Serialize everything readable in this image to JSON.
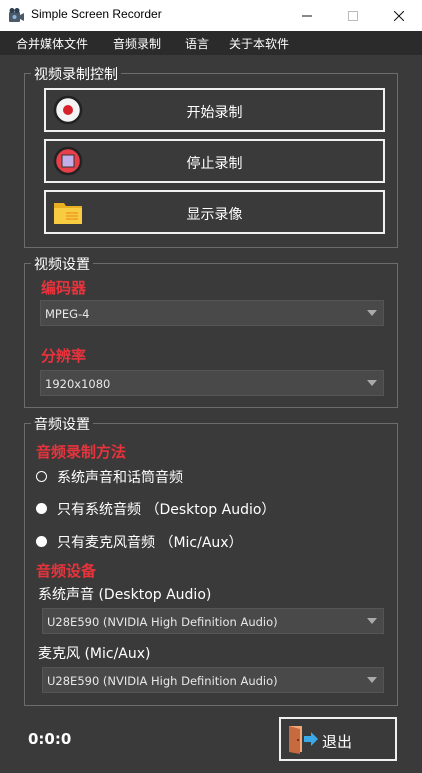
{
  "window": {
    "title": "Simple Screen Recorder"
  },
  "menu": [
    "合并媒体文件",
    "音频录制",
    "语言",
    "关于本软件"
  ],
  "record_group": {
    "title": "视频录制控制",
    "buttons": [
      {
        "label": "开始录制",
        "icon": "record-icon"
      },
      {
        "label": "停止录制",
        "icon": "stop-icon"
      },
      {
        "label": "显示录像",
        "icon": "folder-icon"
      }
    ]
  },
  "video_group": {
    "title": "视频设置",
    "encoder_label": "编码器",
    "encoder_value": "MPEG-4",
    "resolution_label": "分辨率",
    "resolution_value": "1920x1080"
  },
  "audio_group": {
    "title": "音频设置",
    "method_label": "音频录制方法",
    "options": [
      {
        "label": "系统声音和话筒音频",
        "selected": true
      },
      {
        "label": "只有系统音频 （Desktop Audio）",
        "selected": false
      },
      {
        "label": "只有麦克风音频 （Mic/Aux）",
        "selected": false
      }
    ],
    "device_label": "音频设备",
    "system_sound_label": "系统声音 (Desktop Audio)",
    "system_sound_value": "U28E590 (NVIDIA High Definition Audio)",
    "mic_label": "麦克风 (Mic/Aux)",
    "mic_value": "U28E590 (NVIDIA High Definition Audio)"
  },
  "footer": {
    "timer": "0:0:0",
    "exit_label": "退出"
  },
  "colors": {
    "accent_red": "#e8333c",
    "background": "#3a3a3a",
    "menubar": "#2b2b2b"
  }
}
